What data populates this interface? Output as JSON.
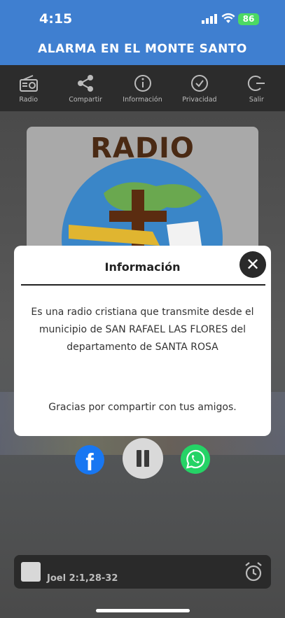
{
  "status_bar": {
    "time": "4:15",
    "battery": "86"
  },
  "app": {
    "title": "ALARMA EN EL MONTE SANTO"
  },
  "toolbar": {
    "items": [
      {
        "label": "Radio",
        "icon": "radio-icon"
      },
      {
        "label": "Compartir",
        "icon": "share-icon"
      },
      {
        "label": "Información",
        "icon": "info-icon"
      },
      {
        "label": "Privacidad",
        "icon": "check-circle-icon"
      },
      {
        "label": "Salir",
        "icon": "exit-icon"
      }
    ]
  },
  "cover": {
    "title": "RADIO"
  },
  "modal": {
    "title": "Información",
    "close": "✕",
    "body": "Es una radio cristiana que transmite desde el municipio de SAN RAFAEL LAS FLORES del departamento de SANTA ROSA",
    "footer": "Gracias por compartir con tus amigos."
  },
  "socials": {
    "facebook": "f"
  },
  "mini_player": {
    "label": "Joel 2:1,28-32"
  },
  "colors": {
    "header": "#3f7fd0",
    "toolbar": "#2c2c2c",
    "facebook": "#1877f2",
    "whatsapp": "#25d366"
  }
}
